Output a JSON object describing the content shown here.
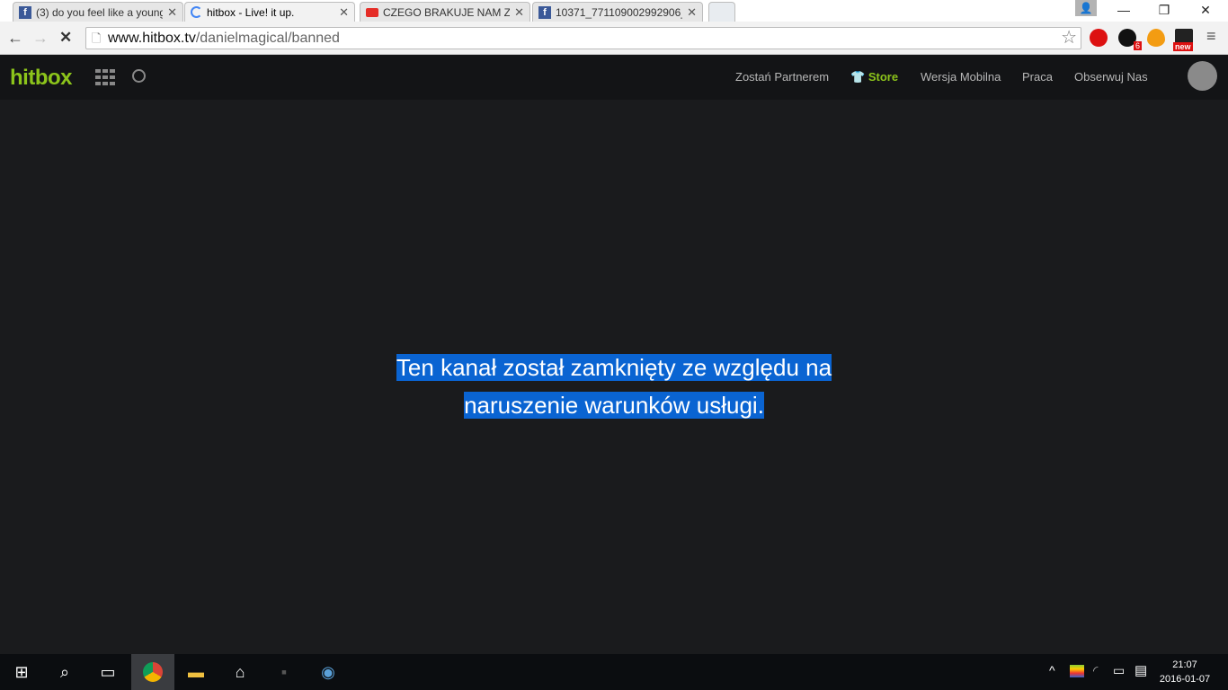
{
  "tabs": [
    {
      "title": "(3) do you feel like a young",
      "icon": "facebook-icon"
    },
    {
      "title": "hitbox - Live! it up.",
      "icon": "loading-icon"
    },
    {
      "title": "CZEGO BRAKUJE NAM Z C",
      "icon": "youtube-icon"
    },
    {
      "title": "10371_771109002992906_",
      "icon": "facebook-icon"
    }
  ],
  "address": {
    "host": "www.hitbox.tv",
    "path": "/danielmagical/banned"
  },
  "extensions": {
    "badge_count": "6",
    "new_label": "new"
  },
  "site": {
    "logo": "hitbox",
    "nav": [
      "Zostań Partnerem",
      "Store",
      "Wersja Mobilna",
      "Praca",
      "Obserwuj Nas"
    ],
    "accent": "#8cc41b"
  },
  "message": {
    "line1": "Ten kanał został zamknięty ze względu na ",
    "line2": "naruszenie warunków usługi."
  },
  "taskbar": {
    "time": "21:07",
    "date": "2016-01-07"
  }
}
